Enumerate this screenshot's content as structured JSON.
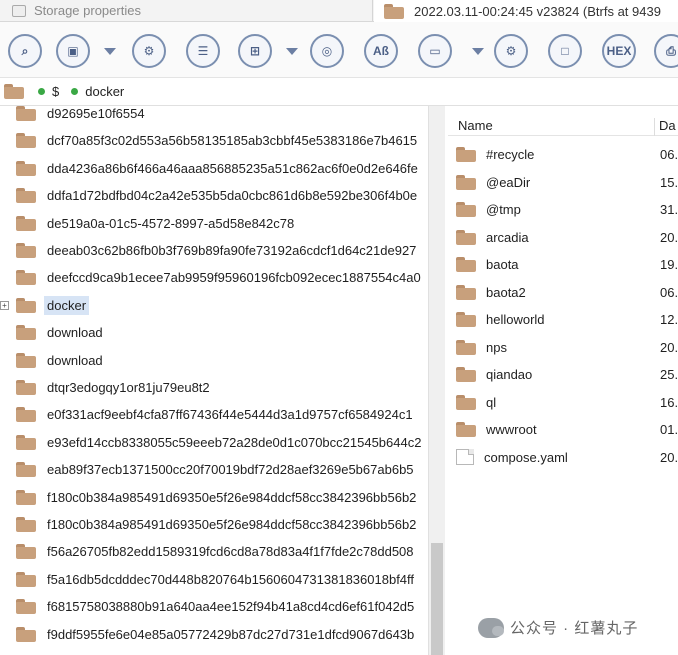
{
  "tabs": {
    "left_label": "Storage properties",
    "right_label": "2022.03.11-00:24:45 v23824 (Btrfs at 9439"
  },
  "toolbar": {
    "buttons": [
      {
        "name": "zoom-icon",
        "glyph": "⌕"
      },
      {
        "name": "save-icon",
        "glyph": "▣"
      },
      {
        "name": "scan-icon",
        "glyph": "⚙"
      },
      {
        "name": "list-icon",
        "glyph": "☰"
      },
      {
        "name": "view-icon",
        "glyph": "⊞"
      },
      {
        "name": "binoculars-icon",
        "glyph": "◎"
      },
      {
        "name": "text-search-icon",
        "glyph": "Aß"
      },
      {
        "name": "card-icon",
        "glyph": "▭"
      },
      {
        "name": "file-gear-icon",
        "glyph": "⚙"
      },
      {
        "name": "file-icon",
        "glyph": "□"
      },
      {
        "name": "hex-icon",
        "glyph": "HEX"
      },
      {
        "name": "print-icon",
        "glyph": "⎙"
      }
    ]
  },
  "path": {
    "segments": [
      "$",
      "docker"
    ]
  },
  "tree": {
    "items": [
      {
        "label": "d92695e10f6554",
        "selected": false
      },
      {
        "label": "dcf70a85f3c02d553a56b58135185ab3cbbf45e5383186e7b4615",
        "selected": false
      },
      {
        "label": "dda4236a86b6f466a46aaa856885235a51c862ac6f0e0d2e646fe",
        "selected": false
      },
      {
        "label": "ddfa1d72bdfbd04c2a42e535b5da0cbc861d6b8e592be306f4b0e",
        "selected": false
      },
      {
        "label": "de519a0a-01c5-4572-8997-a5d58e842c78",
        "selected": false
      },
      {
        "label": "deeab03c62b86fb0b3f769b89fa90fe73192a6cdcf1d64c21de927",
        "selected": false
      },
      {
        "label": "deefccd9ca9b1ecee7ab9959f95960196fcb092ecec1887554c4a0",
        "selected": false
      },
      {
        "label": "docker",
        "selected": true,
        "expandable": true
      },
      {
        "label": "download",
        "selected": false
      },
      {
        "label": "download",
        "selected": false
      },
      {
        "label": "dtqr3edogqy1or81ju79eu8t2",
        "selected": false
      },
      {
        "label": "e0f331acf9eebf4cfa87ff67436f44e5444d3a1d9757cf6584924c1",
        "selected": false
      },
      {
        "label": "e93efd14ccb8338055c59eeeb72a28de0d1c070bcc21545b644c2",
        "selected": false
      },
      {
        "label": "eab89f37ecb1371500cc20f70019bdf72d28aef3269e5b67ab6b5",
        "selected": false
      },
      {
        "label": "f180c0b384a985491d69350e5f26e984ddcf58cc3842396bb56b2",
        "selected": false
      },
      {
        "label": "f180c0b384a985491d69350e5f26e984ddcf58cc3842396bb56b2",
        "selected": false
      },
      {
        "label": "f56a26705fb82edd1589319fcd6cd8a78d83a4f1f7fde2c78dd508",
        "selected": false
      },
      {
        "label": "f5a16db5dcdddec70d448b820764b1560604731381836018bf4ff",
        "selected": false
      },
      {
        "label": "f6815758038880b91a640aa4ee152f94b41a8cd4cd6ef61f042d5",
        "selected": false
      },
      {
        "label": "f9ddf5955fe6e04e85a05772429b87dc27d731e1dfcd9067d643b",
        "selected": false
      }
    ]
  },
  "list": {
    "columns": {
      "name": "Name",
      "date": "Da"
    },
    "items": [
      {
        "name": "#recycle",
        "date": "06.",
        "type": "folder"
      },
      {
        "name": "@eaDir",
        "date": "15.",
        "type": "folder"
      },
      {
        "name": "@tmp",
        "date": "31.",
        "type": "folder"
      },
      {
        "name": "arcadia",
        "date": "20.",
        "type": "folder"
      },
      {
        "name": "baota",
        "date": "19.",
        "type": "folder"
      },
      {
        "name": "baota2",
        "date": "06.",
        "type": "folder"
      },
      {
        "name": "helloworld",
        "date": "12.",
        "type": "folder"
      },
      {
        "name": "nps",
        "date": "20.",
        "type": "folder"
      },
      {
        "name": "qiandao",
        "date": "25.",
        "type": "folder"
      },
      {
        "name": "ql",
        "date": "16.",
        "type": "folder"
      },
      {
        "name": "wwwroot",
        "date": "01.",
        "type": "folder"
      },
      {
        "name": "compose.yaml",
        "date": "20.",
        "type": "file"
      }
    ]
  },
  "watermark": {
    "text": "公众号 · 红薯丸子"
  }
}
